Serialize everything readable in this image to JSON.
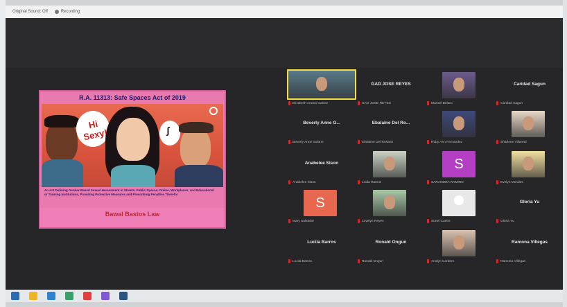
{
  "titlebar": {
    "left_text": "Original Sound: Off",
    "right_text": "Recording"
  },
  "slide": {
    "title": "R.A. 11313:  Safe Spaces Act of 2019",
    "bubble_text": "Hi Sexy!",
    "description": "An Act Defining Gender-Based Sexual Harassment in Streets, Public Spaces, Online, Workplaces, and Educational or Training Institutions, Providing Protective Measures and Prescribing Penalties Therefor",
    "footer": "Bawal Bastos Law",
    "footer_sub": ""
  },
  "participants": [
    {
      "plate": "Elizabeth Aruma Galvez",
      "big": "",
      "kind": "video"
    },
    {
      "plate": "GAD JOSE REYES",
      "big": "GAD JOSE REYES",
      "kind": "name"
    },
    {
      "plate": "Marisel Belaro",
      "big": "",
      "kind": "video"
    },
    {
      "plate": "Caridad Sagun",
      "big": "Caridad Sagun",
      "kind": "name"
    },
    {
      "plate": "Beverly Anne Solano",
      "big": "Beverly Anne G...",
      "kind": "name"
    },
    {
      "plate": "Ebalaine Del Rosario",
      "big": "Ebalaine Del Ro...",
      "kind": "name"
    },
    {
      "plate": "Ruby Ann Fernandez",
      "big": "",
      "kind": "video"
    },
    {
      "plate": "Sharlene Villareal",
      "big": "",
      "kind": "video"
    },
    {
      "plate": "Anabelee Sison",
      "big": "Anabelee Sison",
      "kind": "name"
    },
    {
      "plate": "Loida Ramos",
      "big": "",
      "kind": "video"
    },
    {
      "plate": "SARANDRA RAMIRO",
      "big": "",
      "kind": "letter",
      "letter": "S",
      "color": "#b43fc4"
    },
    {
      "plate": "Evelyn Morales",
      "big": "",
      "kind": "video"
    },
    {
      "plate": "Mary Salvador",
      "big": "",
      "kind": "letter",
      "letter": "S",
      "color": "#e8674f"
    },
    {
      "plate": "Lovelyn Reyes",
      "big": "",
      "kind": "video"
    },
    {
      "plate": "Sunel Carlos",
      "big": "",
      "kind": "blank"
    },
    {
      "plate": "Gloria Yu",
      "big": "Gloria Yu",
      "kind": "name"
    },
    {
      "plate": "Lucila Barros",
      "big": "Lucila Barros",
      "kind": "name"
    },
    {
      "plate": "Ronald Ongun",
      "big": "Ronald Ongun",
      "kind": "name"
    },
    {
      "plate": "Analyn Cordero",
      "big": "",
      "kind": "video"
    },
    {
      "plate": "Ramona Villegas",
      "big": "Ramona Villegas",
      "kind": "name"
    }
  ],
  "colors": {
    "window_bg": "#262628",
    "slide_pink": "#e87ab0",
    "active_border": "#f1e046",
    "mic_muted": "#d8262d"
  }
}
